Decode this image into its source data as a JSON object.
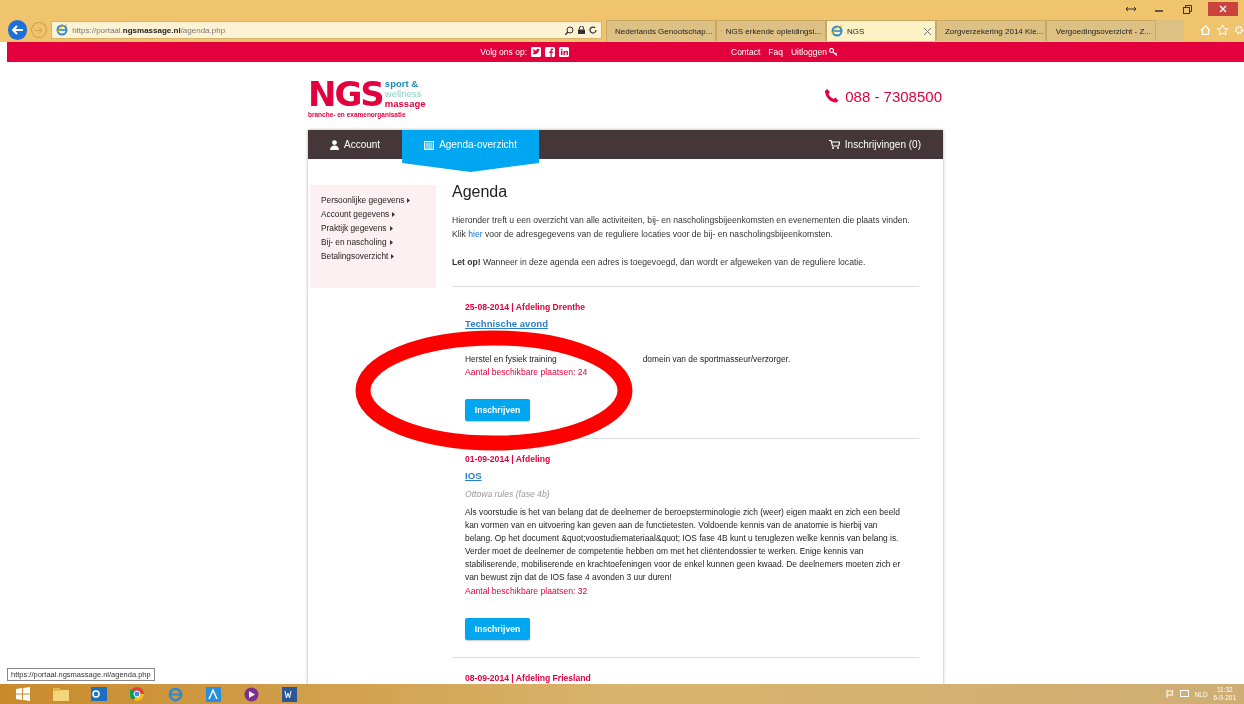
{
  "browser": {
    "address": "https://portaal.**ngsmassage.nl**/agenda.php",
    "tabs": [
      {
        "title": "Nederlands Genootschap...",
        "kind": "linkedin",
        "selected": false
      },
      {
        "title": "NGS erkende opleidingsi...",
        "kind": "ngs",
        "selected": false
      },
      {
        "title": "NGS",
        "kind": "ie",
        "selected": true
      },
      {
        "title": "Zorgverzekering 2014 Kie...",
        "kind": "ie",
        "selected": false
      },
      {
        "title": "Vergoedingsoverzicht - Z...",
        "kind": "doc",
        "selected": false
      }
    ]
  },
  "top_bar": {
    "follow_label": "Volg ons op:",
    "links": [
      "Contact",
      "Faq",
      "Uitloggen"
    ]
  },
  "header": {
    "logo": {
      "letters": "NGS",
      "line_1": "sport &",
      "line_2": "wellness",
      "line_3": "massage",
      "tagline": "branche- en examenorganisatie"
    },
    "phone": "088 - 7308500"
  },
  "nav": {
    "tabs": [
      {
        "label": "Account",
        "kind": "user",
        "selected": false
      },
      {
        "label": "Agenda-overzicht",
        "kind": "calendar",
        "selected": true
      }
    ],
    "cart": "Inschrijvingen (0)"
  },
  "sidebar": {
    "items": [
      "Persoonlijke gegevens",
      "Account gegevens",
      "Praktijk gegevens",
      "Bij- en nascholing",
      "Betalingsoverzicht"
    ]
  },
  "main": {
    "title": "Agenda",
    "intro": {
      "before": "Hieronder treft u een overzicht van alle activiteiten, bij- en nascholingsbijeenkomsten en evenementen die plaats vinden. Klik",
      "link": "hier",
      "after": "voor de adresgegevens van de reguliere locaties voor de bij- en nascholingsbijeenkomsten."
    },
    "notice": "**Let op!** Wanneer in deze agenda een adres is toegevoegd, dan wordt er afgeweken van de reguliere locatie.",
    "events": [
      {
        "date_line": "25-08-2014 | Afdeling Drenthe",
        "title": "Technische avond",
        "description_parts": [
          "Herstel en fysiek training",
          "domein van de sportmasseur/verzorger."
        ],
        "places": "Aantal beschikbare plaatsen: 24",
        "button": "Inschrijven"
      },
      {
        "date_line": "01-09-2014 | Afdeling",
        "title": "IOS",
        "subtitle": "Ottowa rules (fase 4b)",
        "description_parts": [
          "Als voorstudie is het van belang dat de deelnemer de beroepsterminologie zich (weer) eigen maakt en zich een beeld kan vormen van en uitvoering kan geven aan de functietesten. Voldoende kennis van de anatomie is hierbij van belang. Op het document &quot;voostudiemateriaal&quot; IOS fase 4B kunt u teruglezen welke kennis van belang is. Verder moet de deelnemer de competentie hebben om met het cliëntendossier te werken. Enige kennis van stabiliserende, mobiliserende en krachtoefeningen voor de enkel kunnen geen kwaad. De deelnemers moeten zich er van bewust zijn dat de IOS fase 4 avonden 3 uur duren!"
        ],
        "places": "Aantal beschikbare plaatsen: 32",
        "button": "Inschrijven"
      },
      {
        "date_line": "08-09-2014 | Afdeling Friesland"
      }
    ]
  },
  "status_tooltip": "https://portaal.ngsmassage.nl/agenda.php",
  "taskbar": {
    "language": "NLD",
    "time": "11:32",
    "date": "6-9-201"
  }
}
